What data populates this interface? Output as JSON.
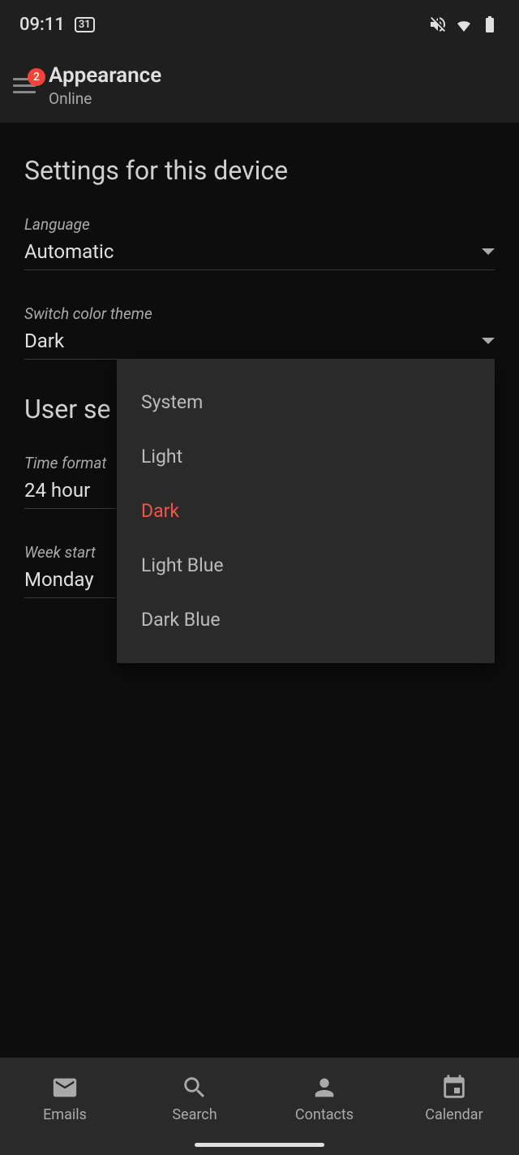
{
  "statusBar": {
    "time": "09:11",
    "calendarDay": "31"
  },
  "header": {
    "badgeCount": "2",
    "title": "Appearance",
    "subtitle": "Online"
  },
  "sections": {
    "deviceSettings": {
      "title": "Settings for this device",
      "language": {
        "label": "Language",
        "value": "Automatic"
      },
      "theme": {
        "label": "Switch color theme",
        "value": "Dark"
      }
    },
    "userSettings": {
      "title": "User se",
      "timeFormat": {
        "label": "Time format",
        "value": "24 hour"
      },
      "weekStart": {
        "label": "Week start",
        "value": "Monday"
      }
    }
  },
  "themeDropdown": {
    "options": [
      "System",
      "Light",
      "Dark",
      "Light Blue",
      "Dark Blue"
    ],
    "selected": "Dark"
  },
  "bottomNav": {
    "emails": "Emails",
    "search": "Search",
    "contacts": "Contacts",
    "calendar": "Calendar"
  }
}
